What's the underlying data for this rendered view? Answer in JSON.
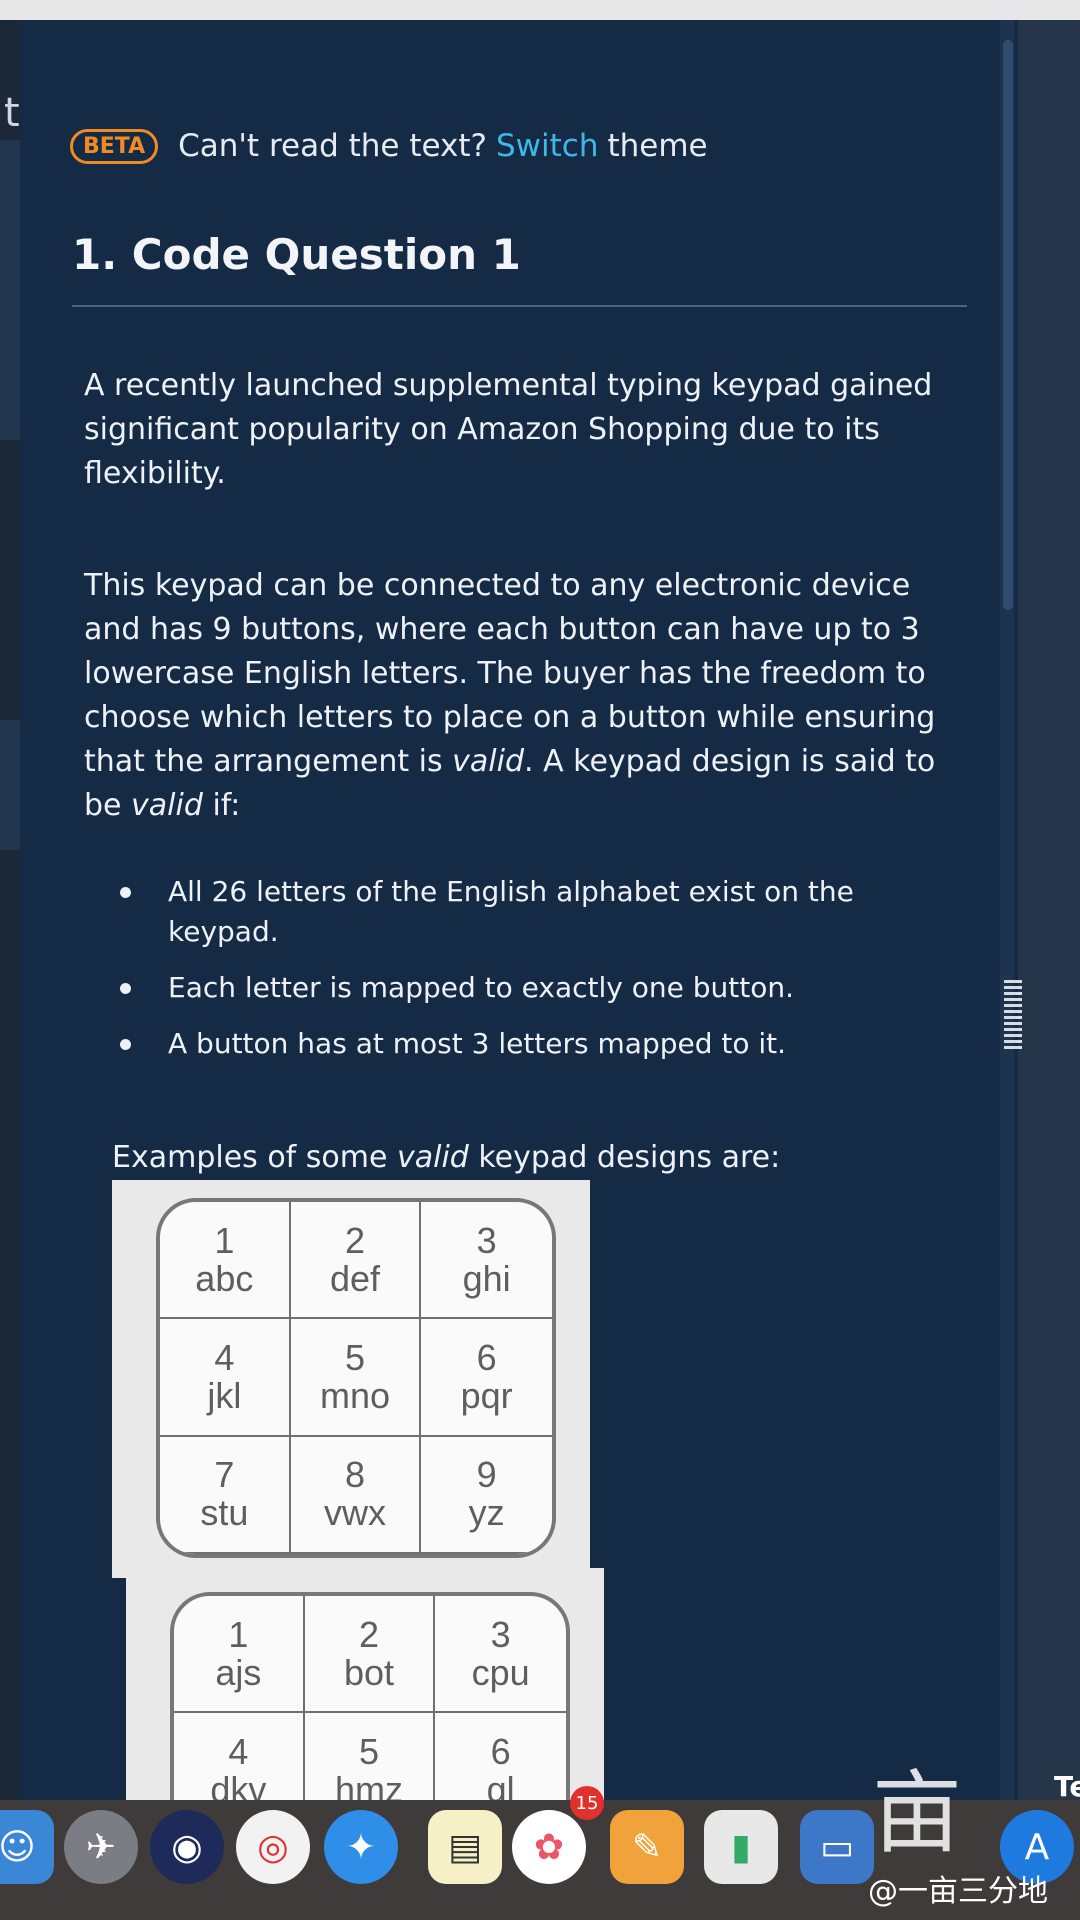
{
  "banner": {
    "badge": "BETA",
    "prefix": "Can't read the text?",
    "link": "Switch",
    "suffix": "theme"
  },
  "question": {
    "title": "1. Code Question 1",
    "para1": "A recently launched supplemental typing keypad gained significant popularity on Amazon Shopping due to its flexibility.",
    "para2_a": "This keypad can be connected to any electronic device and has 9 buttons, where each button can have up to 3 lowercase English letters. The buyer has the freedom to choose which letters to place on a button while ensuring that the arrangement is ",
    "para2_em": "valid",
    "para2_b": ". A keypad design is said to be ",
    "para2_em2": "valid",
    "para2_c": " if:",
    "bullets": [
      "All 26 letters of the English alphabet exist on the keypad.",
      "Each letter is mapped to exactly one button.",
      "A button has at most 3 letters mapped to it."
    ],
    "examples_a": "Examples of some ",
    "examples_em": "valid",
    "examples_b": " keypad designs are:"
  },
  "keypad1": {
    "keys": [
      {
        "num": "1",
        "letters": "abc"
      },
      {
        "num": "2",
        "letters": "def"
      },
      {
        "num": "3",
        "letters": "ghi"
      },
      {
        "num": "4",
        "letters": "jkl"
      },
      {
        "num": "5",
        "letters": "mno"
      },
      {
        "num": "6",
        "letters": "pqr"
      },
      {
        "num": "7",
        "letters": "stu"
      },
      {
        "num": "8",
        "letters": "vwx"
      },
      {
        "num": "9",
        "letters": "yz"
      }
    ]
  },
  "keypad2": {
    "keys": [
      {
        "num": "1",
        "letters": "ajs"
      },
      {
        "num": "2",
        "letters": "bot"
      },
      {
        "num": "3",
        "letters": "cpu"
      },
      {
        "num": "4",
        "letters": "dkv"
      },
      {
        "num": "5",
        "letters": "hmz"
      },
      {
        "num": "6",
        "letters": "gl"
      }
    ]
  },
  "dock": {
    "photos_badge": "15",
    "watermark_text": "@一亩三分地",
    "edge_text": "Te"
  },
  "left_rail": {
    "letter": "t"
  }
}
